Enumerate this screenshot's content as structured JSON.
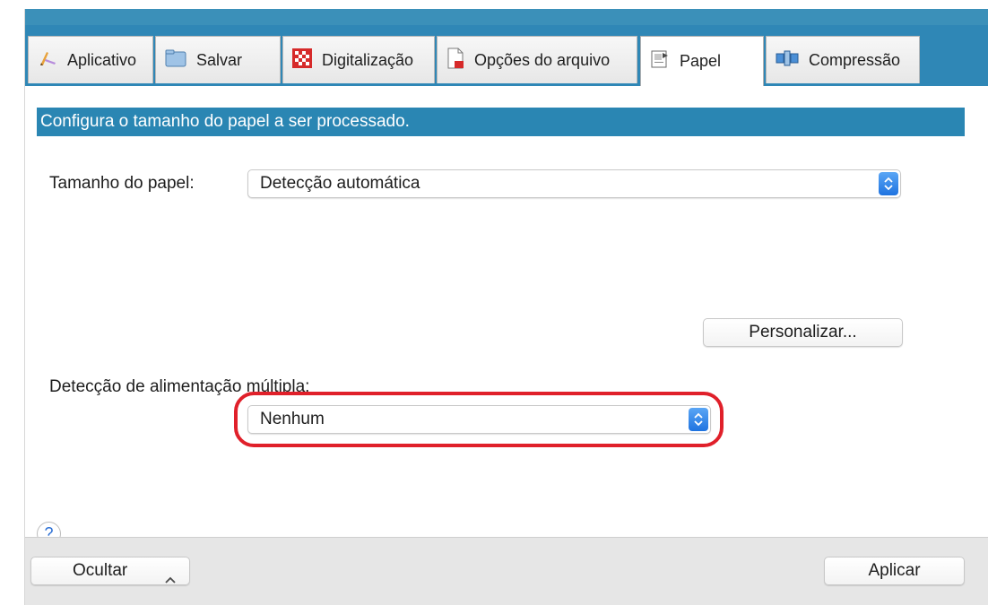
{
  "tabs": [
    {
      "label": "Aplicativo",
      "icon": "pencil-app-icon",
      "active": false
    },
    {
      "label": "Salvar",
      "icon": "folder-icon",
      "active": false
    },
    {
      "label": "Digitalização",
      "icon": "checkerboard-icon",
      "active": false
    },
    {
      "label": "Opções do arquivo",
      "icon": "file-icon",
      "active": false
    },
    {
      "label": "Papel",
      "icon": "paper-icon",
      "active": true
    },
    {
      "label": "Compressão",
      "icon": "compression-icon",
      "active": false
    }
  ],
  "description": "Configura o tamanho do papel a ser processado.",
  "paper_size": {
    "label": "Tamanho do papel:",
    "value": "Detecção automática"
  },
  "customize_button": "Personalizar...",
  "multifeed": {
    "label": "Detecção de alimentação múltipla:",
    "value": "Nenhum"
  },
  "help_label": "?",
  "footer": {
    "hide_label": "Ocultar",
    "apply_label": "Aplicar"
  },
  "colors": {
    "accent_blue": "#2a86b3",
    "highlight_red": "#e0202a",
    "stepper_blue": "#1f73e0"
  }
}
